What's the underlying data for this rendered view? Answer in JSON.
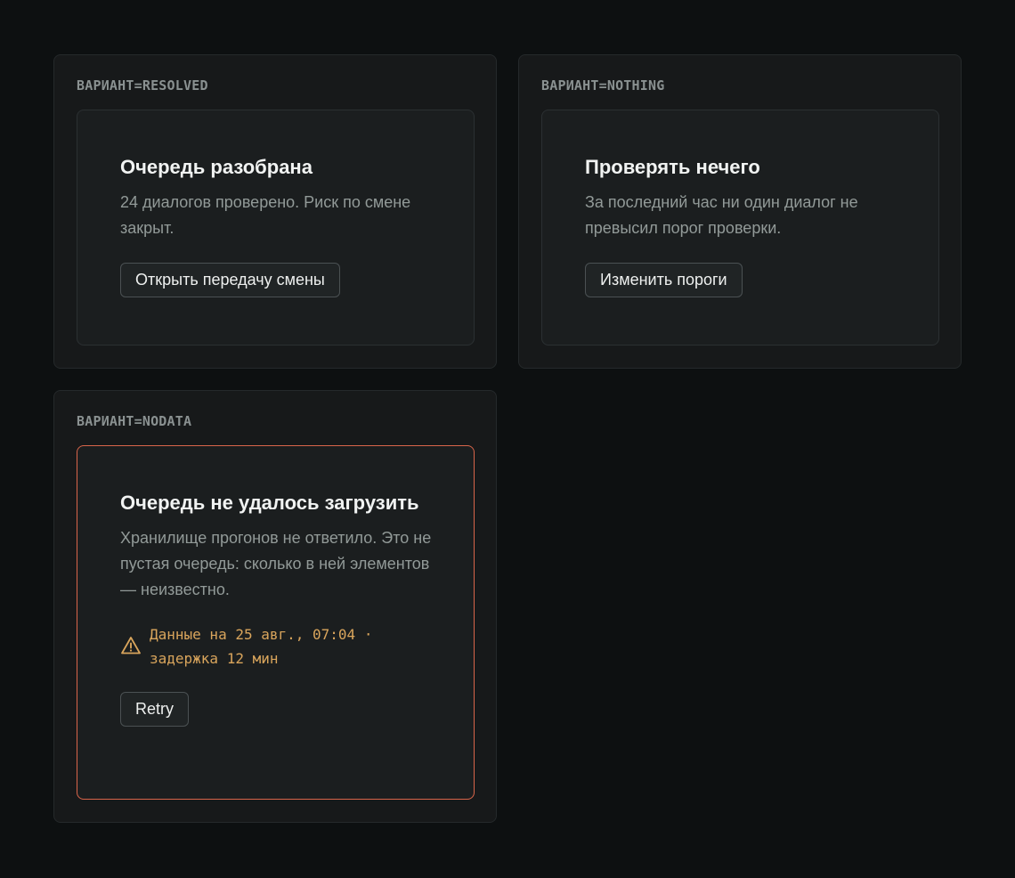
{
  "variants": [
    {
      "label": "ВАРИАНТ=RESOLVED",
      "title": "Очередь разобрана",
      "description": "24 диалогов проверено. Риск по смене закрыт.",
      "button": "Открыть передачу смены"
    },
    {
      "label": "ВАРИАНТ=NOTHING",
      "title": "Проверять нечего",
      "description": "За последний час ни один диалог не превысил порог проверки.",
      "button": "Изменить пороги"
    },
    {
      "label": "ВАРИАНТ=NODATA",
      "title": "Очередь не удалось загрузить",
      "description": "Хранилище прогонов не ответило. Это не пустая очередь: сколько в ней элементов — неизвестно.",
      "warning": "Данные на 25 авг., 07:04 · задержка 12 мин",
      "warning_icon": "warning-triangle-icon",
      "button": "Retry"
    }
  ],
  "colors": {
    "background": "#0d1011",
    "panel": "#17191a",
    "card": "#1b1e1f",
    "error_border": "#d9654a",
    "warning_text": "#d9a55c",
    "muted_text": "#929a98",
    "label_text": "#8a9191"
  }
}
